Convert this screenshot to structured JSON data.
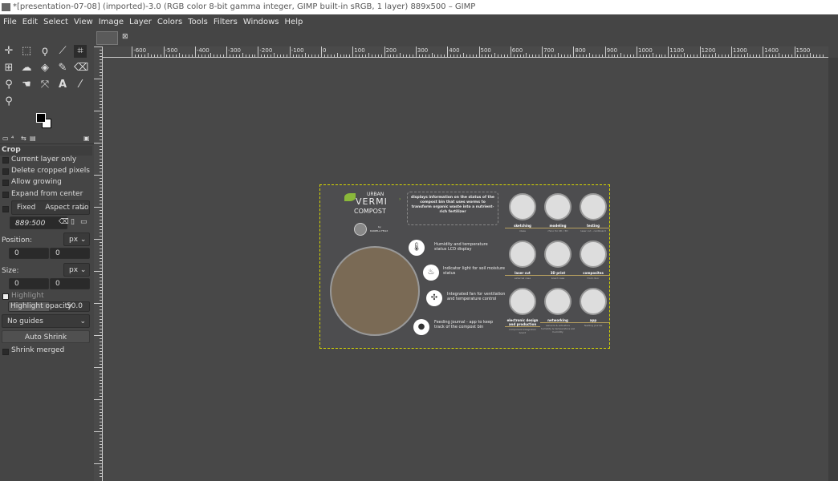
{
  "window": {
    "title": "*[presentation-07-08] (imported)-3.0 (RGB color 8-bit gamma integer, GIMP built-in sRGB, 1 layer) 889x500 – GIMP"
  },
  "menu": [
    "File",
    "Edit",
    "Select",
    "View",
    "Image",
    "Layer",
    "Colors",
    "Tools",
    "Filters",
    "Windows",
    "Help"
  ],
  "tools": [
    "move-icon",
    "rect-select-icon",
    "lasso-icon",
    "fuzzy-select-icon",
    "crop-icon",
    "unified-transform-icon",
    "warp-icon",
    "bucket-fill-icon",
    "paintbrush-icon",
    "eraser-icon",
    "clone-icon",
    "smudge-icon",
    "paths-icon",
    "text-icon",
    "color-picker-icon",
    "zoom-icon"
  ],
  "tool_options": {
    "title": "Crop",
    "current_layer_only": "Current layer only",
    "delete_cropped": "Delete cropped pixels",
    "allow_growing": "Allow growing",
    "expand_center": "Expand from center",
    "fixed": "Fixed",
    "aspect": "Aspect ratio",
    "ratio_value": "889:500",
    "position_label": "Position:",
    "size_label": "Size:",
    "unit": "px",
    "pos_x": "0",
    "pos_y": "0",
    "size_w": "0",
    "size_h": "0",
    "highlight": "Highlight",
    "highlight_opacity": "Highlight opacity",
    "opacity_value": "50.0",
    "guides": "No guides",
    "auto_shrink": "Auto Shrink",
    "shrink_merged": "Shrink merged"
  },
  "ruler": {
    "labels": [
      "-600",
      "-500",
      "-400",
      "-300",
      "-200",
      "-100",
      "0",
      "100",
      "200",
      "300",
      "400",
      "500",
      "600",
      "700",
      "800",
      "900",
      "1000",
      "1100",
      "1200",
      "1300",
      "1400",
      "1500"
    ]
  },
  "poster": {
    "brand1": "URBAN",
    "brand2": "VERMI",
    "brand3": "COMPOST",
    "by": "by",
    "author": "DANIELA FELIX",
    "headline": "displays information on the status of the compost bin that uses worms to transform organic waste into a nutrient-rich fertilizer",
    "features": [
      "Humidity and temperature status LCD display",
      "Indicator light for soil moisture status",
      "Integrated fan for ventilation and temperature control",
      "Feeding journal - app to keep track of the compost bin"
    ],
    "steps": [
      {
        "name": "sketching",
        "sub": "ideas"
      },
      {
        "name": "modeling",
        "sub": "rhino for 2D / 3D"
      },
      {
        "name": "testing",
        "sub": "laser cut - cardboard"
      },
      {
        "name": "laser cut",
        "sub": "external case"
      },
      {
        "name": "3D print",
        "sub": "board case"
      },
      {
        "name": "composites",
        "sub": "front door"
      },
      {
        "name": "electronic design and production",
        "sub": "component integration board"
      },
      {
        "name": "networking",
        "sub": "sensors & actuators humidity & temperature soil humidity"
      },
      {
        "name": "app",
        "sub": "feeding journal"
      }
    ]
  },
  "colors": {
    "canvas": "#484848",
    "ui": "#454545",
    "selection": "#d6d600",
    "accent": "#8ab83a"
  }
}
